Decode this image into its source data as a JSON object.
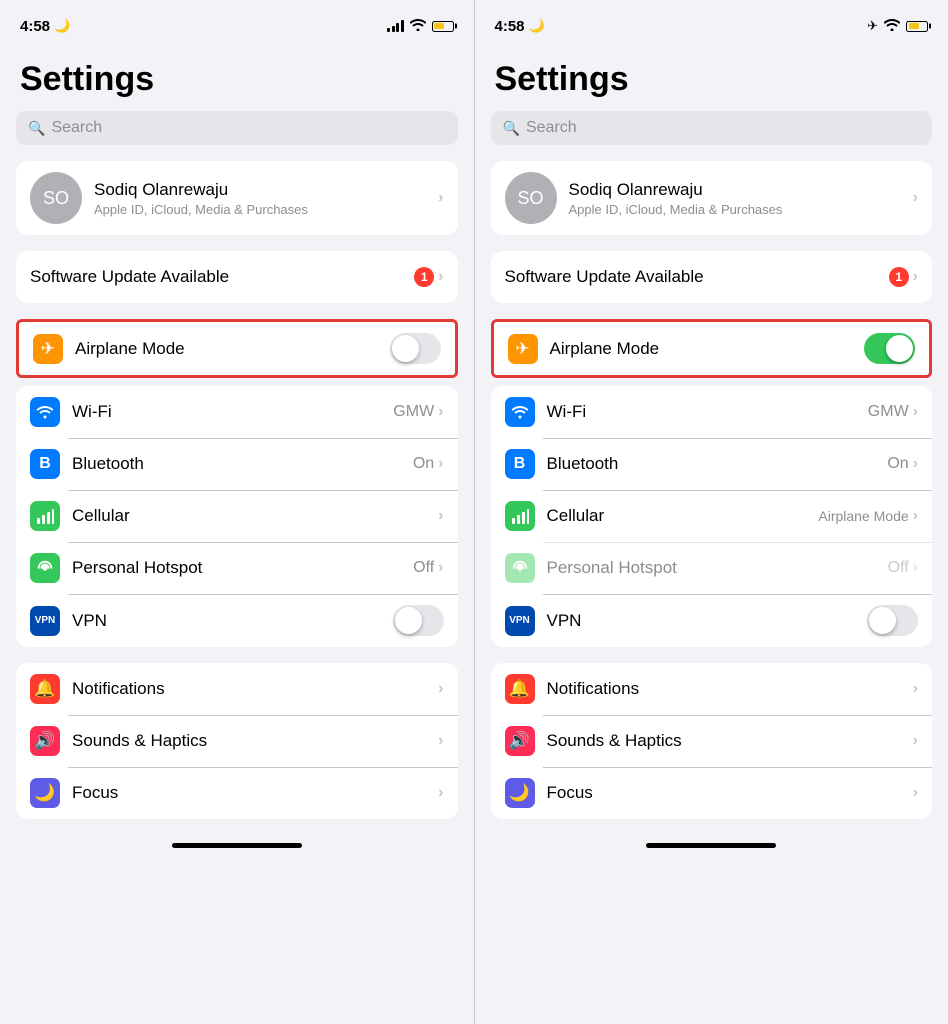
{
  "panel_left": {
    "status": {
      "time": "4:58",
      "moon": true,
      "signal": true,
      "wifi": true,
      "battery": true,
      "airplane_mode": false
    },
    "title": "Settings",
    "search_placeholder": "Search",
    "profile": {
      "initials": "SO",
      "name": "Sodiq Olanrewaju",
      "subtitle": "Apple ID, iCloud, Media & Purchases"
    },
    "software_update": {
      "label": "Software Update Available",
      "badge": "1"
    },
    "airplane_mode": {
      "label": "Airplane Mode",
      "toggle_state": "off"
    },
    "network_items": [
      {
        "label": "Wi-Fi",
        "value": "GMW",
        "icon": "wifi",
        "bg": "bg-blue"
      },
      {
        "label": "Bluetooth",
        "value": "On",
        "icon": "bluetooth",
        "bg": "bg-blue-dark"
      },
      {
        "label": "Cellular",
        "value": "",
        "icon": "cellular",
        "bg": "bg-green"
      },
      {
        "label": "Personal Hotspot",
        "value": "Off",
        "icon": "hotspot",
        "bg": "bg-green2"
      },
      {
        "label": "VPN",
        "value": "",
        "icon": "vpn",
        "bg": "bg-vpn",
        "toggle": "off"
      }
    ],
    "other_items": [
      {
        "label": "Notifications",
        "icon": "bell",
        "bg": "bg-red"
      },
      {
        "label": "Sounds & Haptics",
        "icon": "sound",
        "bg": "bg-pink"
      },
      {
        "label": "Focus",
        "icon": "moon",
        "bg": "bg-purple"
      }
    ]
  },
  "panel_right": {
    "status": {
      "time": "4:58",
      "moon": true,
      "airplane": true,
      "wifi": true,
      "battery": true
    },
    "title": "Settings",
    "search_placeholder": "Search",
    "profile": {
      "initials": "SO",
      "name": "Sodiq Olanrewaju",
      "subtitle": "Apple ID, iCloud, Media & Purchases"
    },
    "software_update": {
      "label": "Software Update Available",
      "badge": "1"
    },
    "airplane_mode": {
      "label": "Airplane Mode",
      "toggle_state": "on"
    },
    "network_items": [
      {
        "label": "Wi-Fi",
        "value": "GMW",
        "icon": "wifi",
        "bg": "bg-blue",
        "grayed": false
      },
      {
        "label": "Bluetooth",
        "value": "On",
        "icon": "bluetooth",
        "bg": "bg-blue-dark",
        "grayed": false
      },
      {
        "label": "Cellular",
        "value": "Airplane Mode",
        "icon": "cellular",
        "bg": "bg-green",
        "grayed": false
      },
      {
        "label": "Personal Hotspot",
        "value": "Off",
        "icon": "hotspot",
        "bg": "bg-green2",
        "grayed": true
      },
      {
        "label": "VPN",
        "value": "",
        "icon": "vpn",
        "bg": "bg-vpn",
        "toggle": "off"
      }
    ],
    "other_items": [
      {
        "label": "Notifications",
        "icon": "bell",
        "bg": "bg-red"
      },
      {
        "label": "Sounds & Haptics",
        "icon": "sound",
        "bg": "bg-pink"
      },
      {
        "label": "Focus",
        "icon": "moon",
        "bg": "bg-purple"
      }
    ]
  }
}
